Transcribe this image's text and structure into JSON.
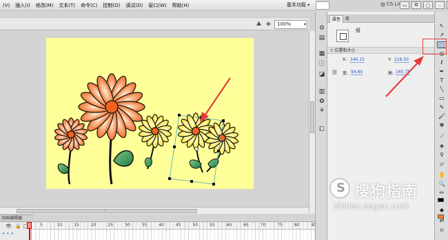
{
  "menu": {
    "items": [
      "(V)",
      "插入(I)",
      "修改(M)",
      "文本(T)",
      "命令(C)",
      "控制(O)",
      "调试(D)",
      "窗口(W)",
      "帮助(H)"
    ]
  },
  "workspace": {
    "label": "基本功能"
  },
  "cs_live": {
    "label": "CS Live"
  },
  "edit_bar": {
    "zoom": "100%"
  },
  "properties_panel": {
    "tabs": [
      "属性",
      "库"
    ],
    "instance_type": "组",
    "section_title": "位置和大小",
    "x_label": "X:",
    "x_value": "346.15",
    "y_label": "Y:",
    "y_value": "218.50",
    "width_label": "宽:",
    "width_value": "94.80",
    "height_label": "高:",
    "height_value": "165.75"
  },
  "timeline": {
    "tab_label": "动画编辑器",
    "frame_numbers": [
      "5",
      "10",
      "15",
      "20",
      "25",
      "30",
      "35",
      "40",
      "45",
      "50",
      "55",
      "60",
      "65",
      "70",
      "75",
      "80",
      "85"
    ]
  },
  "watermark": {
    "title": "搜狗指南",
    "url": "zhinan.sogou.com"
  },
  "colors": {
    "stage_bg": "#ffff99",
    "annotation_red": "#e53b3b",
    "petal_orange": "#f07a3a",
    "petal_yellow": "#ffee55"
  }
}
